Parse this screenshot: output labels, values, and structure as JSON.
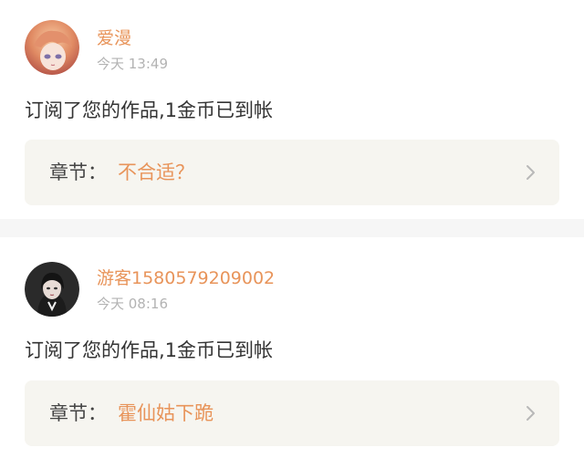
{
  "notifications": [
    {
      "username": "爱漫",
      "time": "今天 13:49",
      "message": "订阅了您的作品,1金币已到帐",
      "chapter_prefix": "章节：",
      "chapter_title": "不合适？",
      "avatar_icon": "anime-avatar-icon",
      "chevron_icon": "chevron-right-icon"
    },
    {
      "username": "游客1580579209002",
      "time": "今天 08:16",
      "message": "订阅了您的作品,1金币已到帐",
      "chapter_prefix": "章节：",
      "chapter_title": "霍仙姑下跪",
      "avatar_icon": "photo-avatar-icon",
      "chevron_icon": "chevron-right-icon"
    }
  ],
  "colors": {
    "accent": "#e8945a",
    "card_bg": "#f6f5f0",
    "divider": "#f6f6f6",
    "text": "#333333",
    "muted": "#b3b3b3"
  }
}
